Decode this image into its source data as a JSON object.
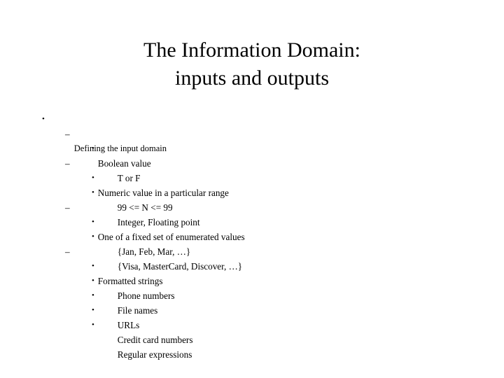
{
  "slide": {
    "background_color": "#ffffff",
    "text_color": "#000000",
    "title": {
      "line1": "The Information Domain:",
      "line2": "inputs and outputs"
    },
    "markers": {
      "level1": "•",
      "level2": "–",
      "level3": "•"
    },
    "bullets": [
      {
        "level": 1,
        "text": "Defining the input domain"
      },
      {
        "level": 2,
        "text": "Boolean value"
      },
      {
        "level": 3,
        "text": "T or F"
      },
      {
        "level": 2,
        "text": "Numeric value in a particular range"
      },
      {
        "level": 3,
        "text": "99 <= N <= 99"
      },
      {
        "level": 3,
        "text": "Integer, Floating point"
      },
      {
        "level": 2,
        "text": "One of a fixed set of enumerated values"
      },
      {
        "level": 3,
        "text": "{Jan, Feb, Mar, …}"
      },
      {
        "level": 3,
        "text": "{Visa, MasterCard, Discover, …}"
      },
      {
        "level": 2,
        "text": "Formatted strings"
      },
      {
        "level": 3,
        "text": "Phone numbers"
      },
      {
        "level": 3,
        "text": "File names"
      },
      {
        "level": 3,
        "text": "URLs"
      },
      {
        "level": 3,
        "text": "Credit card numbers"
      },
      {
        "level": 3,
        "text": "Regular expressions"
      }
    ]
  }
}
